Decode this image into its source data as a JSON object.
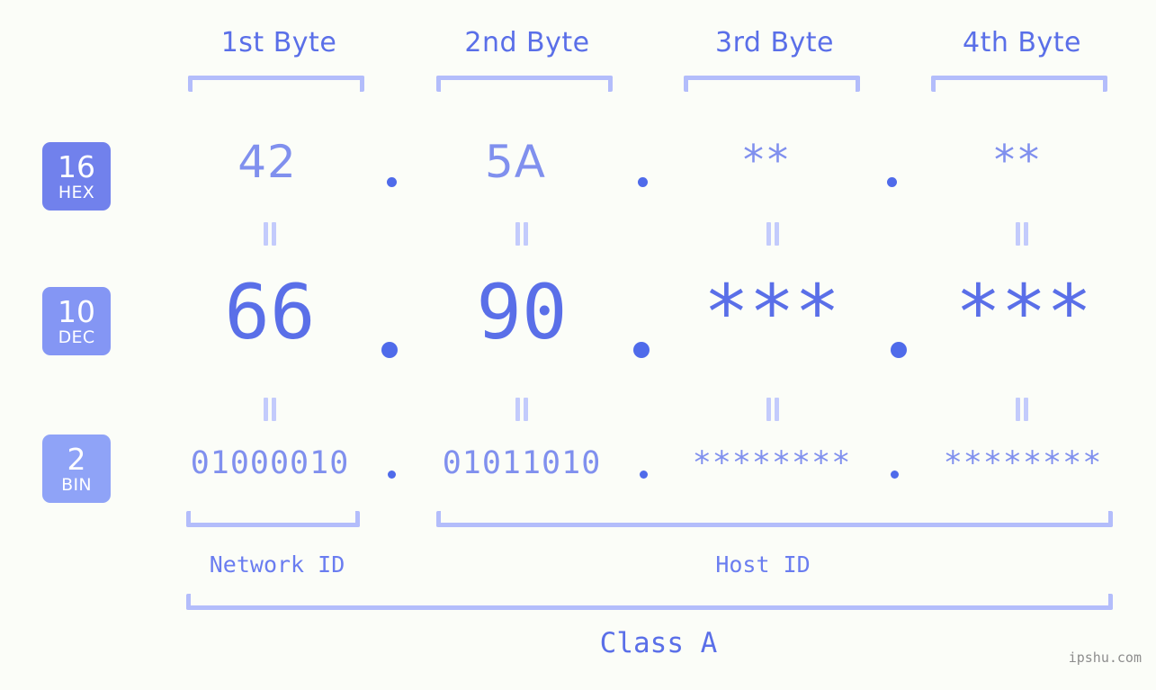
{
  "watermark": "ipshu.com",
  "header": {
    "bytes": [
      {
        "label": "1st Byte"
      },
      {
        "label": "2nd Byte"
      },
      {
        "label": "3rd Byte"
      },
      {
        "label": "4th Byte"
      }
    ]
  },
  "radix_badges": [
    {
      "base": "16",
      "name": "HEX",
      "color": "#7181ec"
    },
    {
      "base": "10",
      "name": "DEC",
      "color": "#8496f4"
    },
    {
      "base": "2",
      "name": "BIN",
      "color": "#8fa3f7"
    }
  ],
  "rows": {
    "hex": {
      "base": "16",
      "name": "HEX",
      "values": [
        "42",
        "5A",
        "**",
        "**"
      ]
    },
    "dec": {
      "base": "10",
      "name": "DEC",
      "values": [
        "66",
        "90",
        "***",
        "***"
      ]
    },
    "bin": {
      "base": "2",
      "name": "BIN",
      "values": [
        "01000010",
        "01011010",
        "********",
        "********"
      ]
    }
  },
  "separators": {
    "dot": ".",
    "equals": "="
  },
  "sections": {
    "network_id": "Network ID",
    "host_id": "Host ID",
    "class": "Class A"
  },
  "colors": {
    "background": "#fbfdf8",
    "accent_dark": "#4f6bea",
    "accent": "#5a6fe8",
    "accent_mid": "#8090ee",
    "accent_light": "#b3bdfb",
    "watermark": "#8d8d8d"
  }
}
